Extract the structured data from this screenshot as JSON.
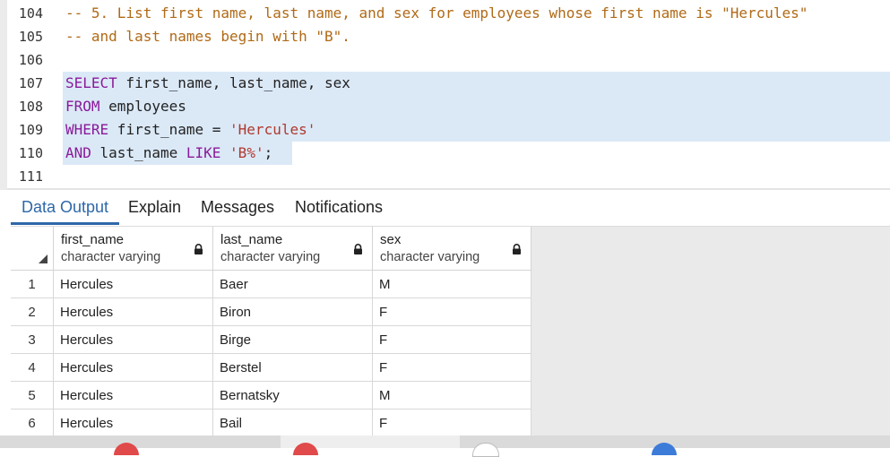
{
  "editor": {
    "lines": [
      {
        "num": "104",
        "segments": [
          {
            "t": "-- 5. List first name, last name, and sex for employees whose first name is \"Hercules\"",
            "c": "comment"
          }
        ]
      },
      {
        "num": "105",
        "segments": [
          {
            "t": "-- and last names begin with \"B\".",
            "c": "comment"
          }
        ]
      },
      {
        "num": "106",
        "segments": []
      },
      {
        "num": "107",
        "segments": [
          {
            "t": "SELECT",
            "c": "kw"
          },
          {
            "t": " first_name, last_name, sex",
            "c": "plain"
          }
        ]
      },
      {
        "num": "108",
        "segments": [
          {
            "t": "FROM",
            "c": "kw"
          },
          {
            "t": " employees",
            "c": "plain"
          }
        ]
      },
      {
        "num": "109",
        "segments": [
          {
            "t": "WHERE",
            "c": "kw"
          },
          {
            "t": " first_name = ",
            "c": "plain"
          },
          {
            "t": "'Hercules'",
            "c": "str"
          }
        ]
      },
      {
        "num": "110",
        "segments": [
          {
            "t": "AND",
            "c": "kw"
          },
          {
            "t": " last_name ",
            "c": "plain"
          },
          {
            "t": "LIKE",
            "c": "kw"
          },
          {
            "t": " ",
            "c": "plain"
          },
          {
            "t": "'B%'",
            "c": "str"
          },
          {
            "t": ";",
            "c": "plain"
          }
        ]
      },
      {
        "num": "111",
        "segments": []
      }
    ]
  },
  "tabs": [
    {
      "label": "Data Output",
      "active": true
    },
    {
      "label": "Explain",
      "active": false
    },
    {
      "label": "Messages",
      "active": false
    },
    {
      "label": "Notifications",
      "active": false
    }
  ],
  "grid": {
    "columns": [
      {
        "name": "first_name",
        "type": "character varying"
      },
      {
        "name": "last_name",
        "type": "character varying"
      },
      {
        "name": "sex",
        "type": "character varying"
      }
    ],
    "rows": [
      {
        "n": "1",
        "cells": [
          "Hercules",
          "Baer",
          "M"
        ]
      },
      {
        "n": "2",
        "cells": [
          "Hercules",
          "Biron",
          "F"
        ]
      },
      {
        "n": "3",
        "cells": [
          "Hercules",
          "Birge",
          "F"
        ]
      },
      {
        "n": "4",
        "cells": [
          "Hercules",
          "Berstel",
          "F"
        ]
      },
      {
        "n": "5",
        "cells": [
          "Hercules",
          "Bernatsky",
          "M"
        ]
      },
      {
        "n": "6",
        "cells": [
          "Hercules",
          "Bail",
          "F"
        ]
      }
    ]
  },
  "colors": {
    "accent": "#2e67a8",
    "keyword": "#8a1a9a",
    "comment": "#b06a17",
    "string": "#b0392e",
    "selection": "#dbe9f7"
  }
}
